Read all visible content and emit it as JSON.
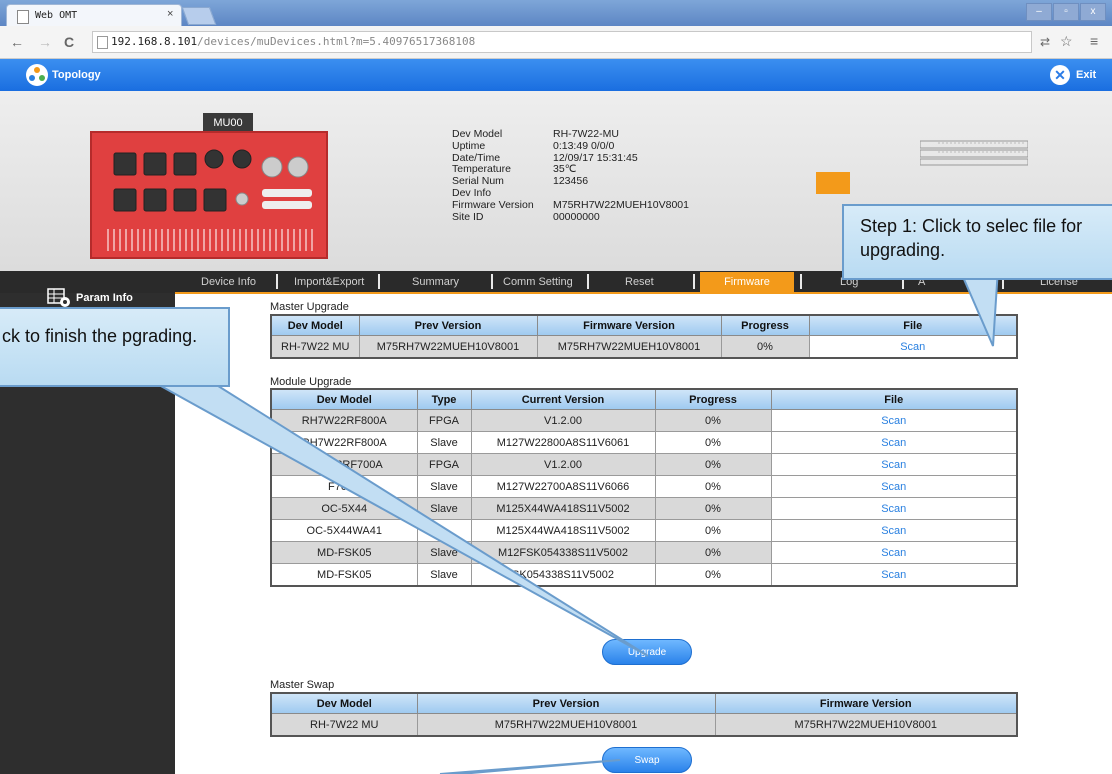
{
  "browser": {
    "tab_title": "Web OMT",
    "tab_close": "×",
    "window_buttons": [
      "–",
      "▫",
      "x"
    ],
    "url_host": "192.168.8.101",
    "url_path": "/devices/muDevices.html?m=5.40976517368108"
  },
  "app": {
    "topology_label": "Topology",
    "exit_label": "Exit"
  },
  "device": {
    "tag": "MU00",
    "info_keys": [
      "Dev Model",
      "Uptime",
      "Date/Time",
      "Temperature",
      "Serial Num",
      "Dev Info",
      "Firmware Version",
      "Site ID"
    ],
    "info_values": [
      "RH-7W22-MU",
      "0:13:49 0/0/0",
      "12/09/17 15:31:45",
      "35℃",
      "123456",
      "",
      "M75RH7W22MUEH10V8001",
      "00000000"
    ]
  },
  "menu": {
    "items": [
      "Device Info",
      "Import&Export",
      "Summary",
      "Comm Setting",
      "Reset",
      "Firmware",
      "Log",
      "A",
      "License"
    ],
    "active": "Firmware"
  },
  "sidebar": {
    "param_info": "Param Info"
  },
  "callouts": {
    "step1": "Step 1: Click to selec file for upgrading.",
    "step2": "ck to finish the pgrading."
  },
  "master_upgrade": {
    "label": "Master Upgrade",
    "headers": [
      "Dev Model",
      "Prev Version",
      "Firmware Version",
      "Progress",
      "File"
    ],
    "rows": [
      {
        "dev_model": "RH-7W22 MU",
        "prev_version": "M75RH7W22MUEH10V8001",
        "firmware_version": "M75RH7W22MUEH10V8001",
        "progress": "0%",
        "file_action": "Scan"
      }
    ]
  },
  "module_upgrade": {
    "label": "Module Upgrade",
    "headers": [
      "Dev Model",
      "Type",
      "Current Version",
      "Progress",
      "File"
    ],
    "rows": [
      {
        "dev_model": "RH7W22RF800A",
        "type": "FPGA",
        "current_version": "V1.2.00",
        "progress": "0%",
        "file_action": "Scan"
      },
      {
        "dev_model": "RH7W22RF800A",
        "type": "Slave",
        "current_version": "M127W22800A8S11V6061",
        "progress": "0%",
        "file_action": "Scan"
      },
      {
        "dev_model": "H7W22RF700A",
        "type": "FPGA",
        "current_version": "V1.2.00",
        "progress": "0%",
        "file_action": "Scan"
      },
      {
        "dev_model": "F700A",
        "type": "Slave",
        "current_version": "M127W22700A8S11V6066",
        "progress": "0%",
        "file_action": "Scan"
      },
      {
        "dev_model": "OC-5X44",
        "type": "Slave",
        "current_version": "M125X44WA418S11V5002",
        "progress": "0%",
        "file_action": "Scan"
      },
      {
        "dev_model": "OC-5X44WA41",
        "type": "",
        "current_version": "M125X44WA418S11V5002",
        "progress": "0%",
        "file_action": "Scan"
      },
      {
        "dev_model": "MD-FSK05",
        "type": "Slave",
        "current_version": "M12FSK054338S11V5002",
        "progress": "0%",
        "file_action": "Scan"
      },
      {
        "dev_model": "MD-FSK05",
        "type": "Slave",
        "current_version": "SK054338S11V5002",
        "progress": "0%",
        "file_action": "Scan"
      }
    ],
    "upgrade_button": "Upgrade"
  },
  "master_swap": {
    "label": "Master Swap",
    "headers": [
      "Dev Model",
      "Prev Version",
      "Firmware Version"
    ],
    "rows": [
      {
        "dev_model": "RH-7W22 MU",
        "prev_version": "M75RH7W22MUEH10V8001",
        "firmware_version": "M75RH7W22MUEH10V8001"
      }
    ],
    "swap_button": "Swap"
  }
}
